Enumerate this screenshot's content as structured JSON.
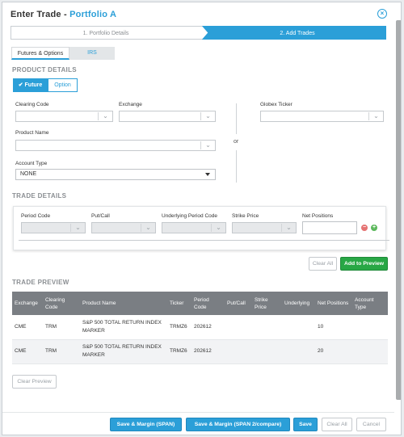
{
  "dialog": {
    "title_prefix": "Enter Trade - ",
    "title_portfolio": "Portfolio A",
    "close_icon": "close-circle-icon"
  },
  "wizard": {
    "step1": "1. Portfolio Details",
    "step2": "2. Add Trades",
    "active_color": "#2b9fd8"
  },
  "tabs": {
    "futures_options": "Futures & Options",
    "irs": "IRS"
  },
  "product_details": {
    "heading": "PRODUCT DETAILS",
    "future_label": "Future",
    "option_label": "Option",
    "clearing_code_label": "Clearing Code",
    "exchange_label": "Exchange",
    "globex_label": "Globex Ticker",
    "product_name_label": "Product Name",
    "or_label": "or",
    "account_type_label": "Account Type",
    "account_type_value": "NONE"
  },
  "trade_details": {
    "heading": "TRADE DETAILS",
    "period_code_label": "Period Code",
    "put_call_label": "Put/Call",
    "underlying_label": "Underlying Period Code",
    "strike_label": "Strike Price",
    "net_positions_label": "Net Positions",
    "clear_all": "Clear All",
    "add_to_preview": "Add to Preview"
  },
  "trade_preview": {
    "heading": "TRADE PREVIEW",
    "columns": [
      "Exchange",
      "Clearing Code",
      "Product Name",
      "Ticker",
      "Period Code",
      "Put/Call",
      "Strike Price",
      "Underlying",
      "Net Positions",
      "Account Type"
    ],
    "rows": [
      {
        "exchange": "CME",
        "clearing_code": "TRM",
        "product_name": "S&P 500 TOTAL RETURN INDEX MARKER",
        "ticker": "TRMZ6",
        "period_code": "202612",
        "put_call": "",
        "strike": "",
        "underlying": "",
        "net_positions": "10",
        "account_type": ""
      },
      {
        "exchange": "CME",
        "clearing_code": "TRM",
        "product_name": "S&P 500 TOTAL RETURN INDEX MARKER",
        "ticker": "TRMZ6",
        "period_code": "202612",
        "put_call": "",
        "strike": "",
        "underlying": "",
        "net_positions": "20",
        "account_type": ""
      }
    ],
    "clear_preview": "Clear Preview"
  },
  "footer": {
    "save_margin_span": "Save & Margin (SPAN)",
    "save_margin_span2": "Save & Margin (SPAN 2/compare)",
    "save": "Save",
    "clear_all": "Clear All",
    "cancel": "Cancel"
  },
  "colors": {
    "accent": "#2b9fd8",
    "success": "#28a745",
    "header_gray": "#7a7e83"
  }
}
